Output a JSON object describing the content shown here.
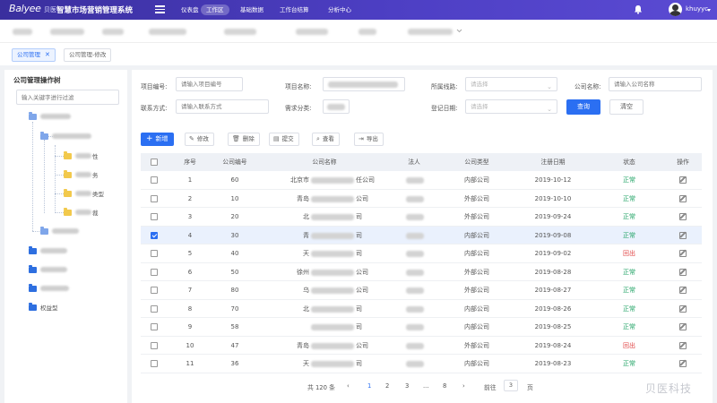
{
  "app": {
    "logo": "Balyee",
    "logo_cn": "贝医",
    "title": "智慧市场营销管理系统"
  },
  "topnav": {
    "items": [
      {
        "label": "仪表盘",
        "active": false
      },
      {
        "label": "工作区",
        "active": true
      },
      {
        "label": "基础数据",
        "active": false
      },
      {
        "label": "工作台结算",
        "active": false
      },
      {
        "label": "分析中心",
        "active": false
      }
    ],
    "username": "khuyyc"
  },
  "tabs": [
    {
      "label": "公司管理",
      "active": true,
      "closable": true
    },
    {
      "label": "公司管理-修改",
      "active": false,
      "closable": false
    }
  ],
  "sidebar": {
    "title": "公司管理操作树",
    "search_placeholder": "输入关键字进行过滤",
    "tree": {
      "leaf_labels": [
        "性",
        "务",
        "类型",
        "裁"
      ],
      "bottom_label": "权益型"
    }
  },
  "filters": {
    "project_no": {
      "label": "项目编号:",
      "placeholder": "请输入项目编号"
    },
    "project_name": {
      "label": "项目名称:"
    },
    "route": {
      "label": "所属线路:",
      "placeholder": "请选择"
    },
    "company_name": {
      "label": "公司名称:",
      "placeholder": "请输入公司名称"
    },
    "contact": {
      "label": "联系方式:",
      "placeholder": "请输入联系方式"
    },
    "demand": {
      "label": "需求分类:"
    },
    "reg_date": {
      "label": "登记日期:",
      "placeholder": "请选择"
    },
    "query_button": "查询",
    "clear_button": "清空"
  },
  "toolbar": {
    "add": "新增",
    "edit": "修改",
    "delete": "删除",
    "submit": "提交",
    "view": "查看",
    "export": "导出"
  },
  "table": {
    "headers": [
      "序号",
      "公司编号",
      "公司名称",
      "法人",
      "公司类型",
      "注册日期",
      "状态",
      "操作"
    ],
    "rows": [
      {
        "seq": "1",
        "code": "60",
        "name_prefix": "北京市",
        "name_suffix": "任公司",
        "type": "内部公司",
        "date": "2019-10-12",
        "status": "正常",
        "checked": false
      },
      {
        "seq": "2",
        "code": "10",
        "name_prefix": "青岛",
        "name_suffix": "公司",
        "type": "外部公司",
        "date": "2019-10-10",
        "status": "正常",
        "checked": false
      },
      {
        "seq": "3",
        "code": "20",
        "name_prefix": "北",
        "name_suffix": "司",
        "type": "外部公司",
        "date": "2019-09-24",
        "status": "正常",
        "checked": false
      },
      {
        "seq": "4",
        "code": "30",
        "name_prefix": "青",
        "name_suffix": "司",
        "type": "内部公司",
        "date": "2019-09-08",
        "status": "正常",
        "checked": true
      },
      {
        "seq": "5",
        "code": "40",
        "name_prefix": "天",
        "name_suffix": "司",
        "type": "内部公司",
        "date": "2019-09-02",
        "status": "回出",
        "checked": false
      },
      {
        "seq": "6",
        "code": "50",
        "name_prefix": "徐州",
        "name_suffix": "公司",
        "type": "外部公司",
        "date": "2019-08-28",
        "status": "正常",
        "checked": false
      },
      {
        "seq": "7",
        "code": "80",
        "name_prefix": "乌",
        "name_suffix": "公司",
        "type": "外部公司",
        "date": "2019-08-27",
        "status": "正常",
        "checked": false
      },
      {
        "seq": "8",
        "code": "70",
        "name_prefix": "北",
        "name_suffix": "司",
        "type": "内部公司",
        "date": "2019-08-26",
        "status": "正常",
        "checked": false
      },
      {
        "seq": "9",
        "code": "58",
        "name_prefix": "",
        "name_suffix": "司",
        "type": "内部公司",
        "date": "2019-08-25",
        "status": "正常",
        "checked": false
      },
      {
        "seq": "10",
        "code": "47",
        "name_prefix": "青岛",
        "name_suffix": "公司",
        "type": "外部公司",
        "date": "2019-08-24",
        "status": "回出",
        "checked": false
      },
      {
        "seq": "11",
        "code": "36",
        "name_prefix": "天",
        "name_suffix": "司",
        "type": "内部公司",
        "date": "2019-08-23",
        "status": "正常",
        "checked": false
      }
    ]
  },
  "pagination": {
    "total": "共 120 条",
    "pages": [
      "1",
      "2",
      "3",
      "...",
      "8"
    ],
    "current": "1",
    "goto_label": "前往",
    "goto_value": "3",
    "page_unit": "页"
  },
  "watermark": "贝医科技",
  "colors": {
    "primary": "#2b6ff2",
    "nav_bg": "#4d3fc4",
    "status_normal": "#21a366",
    "status_out": "#e04545"
  }
}
